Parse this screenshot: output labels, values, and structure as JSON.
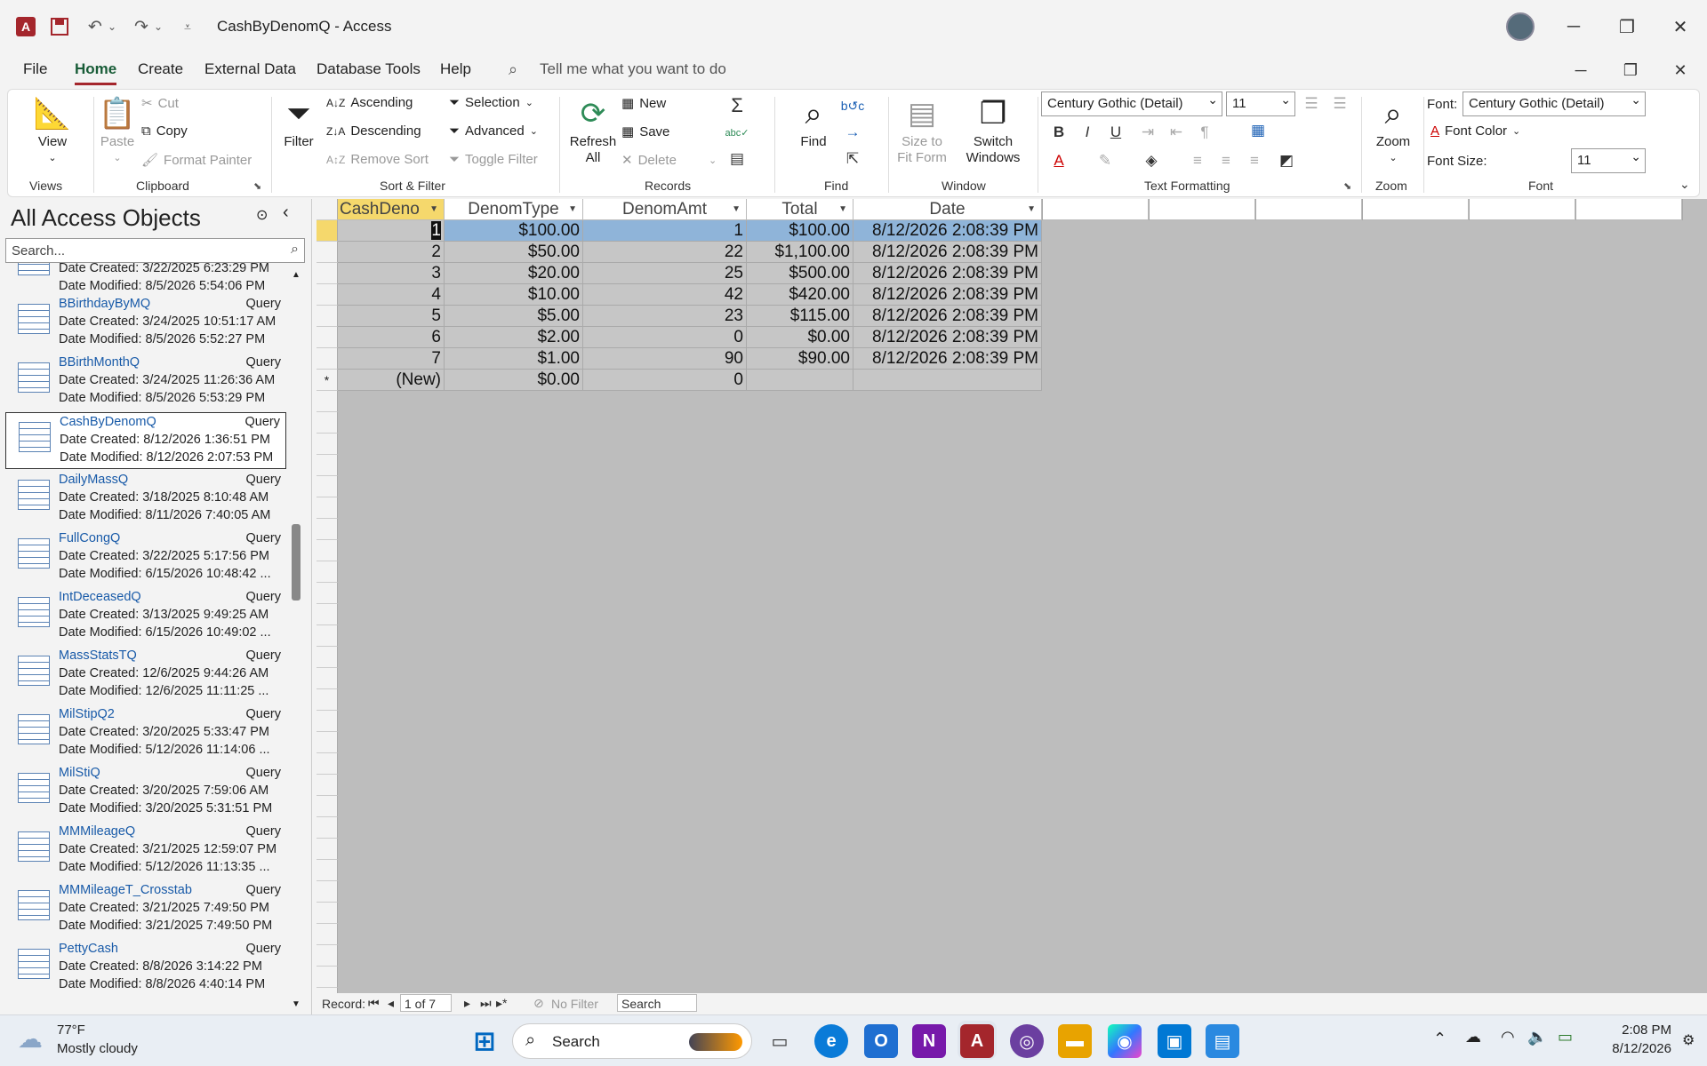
{
  "window": {
    "title": "CashByDenomQ  -  Access"
  },
  "tabs": [
    {
      "label": "File"
    },
    {
      "label": "Home"
    },
    {
      "label": "Create"
    },
    {
      "label": "External Data"
    },
    {
      "label": "Database Tools"
    },
    {
      "label": "Help"
    }
  ],
  "tellme": "Tell me what you want to do",
  "ribbon": {
    "views": {
      "label": "Views",
      "view": "View"
    },
    "clipboard": {
      "label": "Clipboard",
      "paste": "Paste",
      "cut": "Cut",
      "copy": "Copy",
      "format_painter": "Format Painter"
    },
    "sortfilter": {
      "label": "Sort & Filter",
      "filter": "Filter",
      "ascending": "Ascending",
      "descending": "Descending",
      "remove_sort": "Remove Sort",
      "selection": "Selection",
      "advanced": "Advanced",
      "toggle_filter": "Toggle Filter"
    },
    "records": {
      "label": "Records",
      "refresh": "Refresh",
      "refresh_all": "All",
      "new": "New",
      "save": "Save",
      "delete": "Delete"
    },
    "find": {
      "label": "Find",
      "find": "Find"
    },
    "window": {
      "label": "Window",
      "size_to_fit": "Size to",
      "size_to_fit2": "Fit Form",
      "switch": "Switch",
      "switch2": "Windows"
    },
    "textformatting": {
      "label": "Text Formatting",
      "font": "Century Gothic (Detail)",
      "size": "11"
    },
    "zoom": {
      "label": "Zoom",
      "zoom": "Zoom"
    },
    "fontgroup": {
      "label": "Font",
      "font_label": "Font:",
      "font": "Century Gothic (Detail)",
      "font_color": "Font Color",
      "size_label": "Font Size:",
      "size": "11"
    }
  },
  "nav": {
    "title": "All Access Objects",
    "search_placeholder": "Search...",
    "partial": {
      "created": "Date Created: 3/22/2025 6:23:29 PM",
      "modified": "Date Modified: 8/5/2026 5:54:06 PM"
    },
    "items": [
      {
        "name": "BBirthdayByMQ",
        "type": "Query",
        "created": "Date Created: 3/24/2025 10:51:17 AM",
        "modified": "Date Modified: 8/5/2026 5:52:27 PM"
      },
      {
        "name": "BBirthMonthQ",
        "type": "Query",
        "created": "Date Created: 3/24/2025 11:26:36 AM",
        "modified": "Date Modified: 8/5/2026 5:53:29 PM"
      },
      {
        "name": "CashByDenomQ",
        "type": "Query",
        "created": "Date Created: 8/12/2026 1:36:51 PM",
        "modified": "Date Modified: 8/12/2026 2:07:53 PM"
      },
      {
        "name": "DailyMassQ",
        "type": "Query",
        "created": "Date Created: 3/18/2025 8:10:48 AM",
        "modified": "Date Modified: 8/11/2026 7:40:05 AM"
      },
      {
        "name": "FullCongQ",
        "type": "Query",
        "created": "Date Created: 3/22/2025 5:17:56 PM",
        "modified": "Date Modified: 6/15/2026 10:48:42 ..."
      },
      {
        "name": "IntDeceasedQ",
        "type": "Query",
        "created": "Date Created: 3/13/2025 9:49:25 AM",
        "modified": "Date Modified: 6/15/2026 10:49:02 ..."
      },
      {
        "name": "MassStatsTQ",
        "type": "Query",
        "created": "Date Created: 12/6/2025 9:44:26 AM",
        "modified": "Date Modified: 12/6/2025 11:11:25 ..."
      },
      {
        "name": "MilStipQ2",
        "type": "Query",
        "created": "Date Created: 3/20/2025 5:33:47 PM",
        "modified": "Date Modified: 5/12/2026 11:14:06 ..."
      },
      {
        "name": "MilStiQ",
        "type": "Query",
        "created": "Date Created: 3/20/2025 7:59:06 AM",
        "modified": "Date Modified: 3/20/2025 5:31:51 PM"
      },
      {
        "name": "MMMileageQ",
        "type": "Query",
        "created": "Date Created: 3/21/2025 12:59:07 PM",
        "modified": "Date Modified: 5/12/2026 11:13:35 ..."
      },
      {
        "name": "MMMileageT_Crosstab",
        "type": "Query",
        "created": "Date Created: 3/21/2025 7:49:50 PM",
        "modified": "Date Modified: 3/21/2025 7:49:50 PM"
      },
      {
        "name": "PettyCash",
        "type": "Query",
        "created": "Date Created: 8/8/2026 3:14:22 PM",
        "modified": "Date Modified: 8/8/2026 4:40:14 PM"
      }
    ]
  },
  "datasheet": {
    "columns": [
      "CashDeno",
      "DenomType",
      "DenomAmt",
      "Total",
      "Date"
    ],
    "rows": [
      [
        "1",
        "$100.00",
        "1",
        "$100.00",
        "8/12/2026 2:08:39 PM"
      ],
      [
        "2",
        "$50.00",
        "22",
        "$1,100.00",
        "8/12/2026 2:08:39 PM"
      ],
      [
        "3",
        "$20.00",
        "25",
        "$500.00",
        "8/12/2026 2:08:39 PM"
      ],
      [
        "4",
        "$10.00",
        "42",
        "$420.00",
        "8/12/2026 2:08:39 PM"
      ],
      [
        "5",
        "$5.00",
        "23",
        "$115.00",
        "8/12/2026 2:08:39 PM"
      ],
      [
        "6",
        "$2.00",
        "0",
        "$0.00",
        "8/12/2026 2:08:39 PM"
      ],
      [
        "7",
        "$1.00",
        "90",
        "$90.00",
        "8/12/2026 2:08:39 PM"
      ]
    ],
    "new_row": [
      "(New)",
      "$0.00",
      "0",
      "",
      ""
    ]
  },
  "recordnav": {
    "label": "Record:",
    "position": "1 of 7",
    "filter": "No Filter",
    "search": "Search"
  },
  "taskbar": {
    "weather_temp": "77°F",
    "weather_desc": "Mostly cloudy",
    "search": "Search",
    "time": "2:08 PM",
    "date": "8/12/2026"
  }
}
